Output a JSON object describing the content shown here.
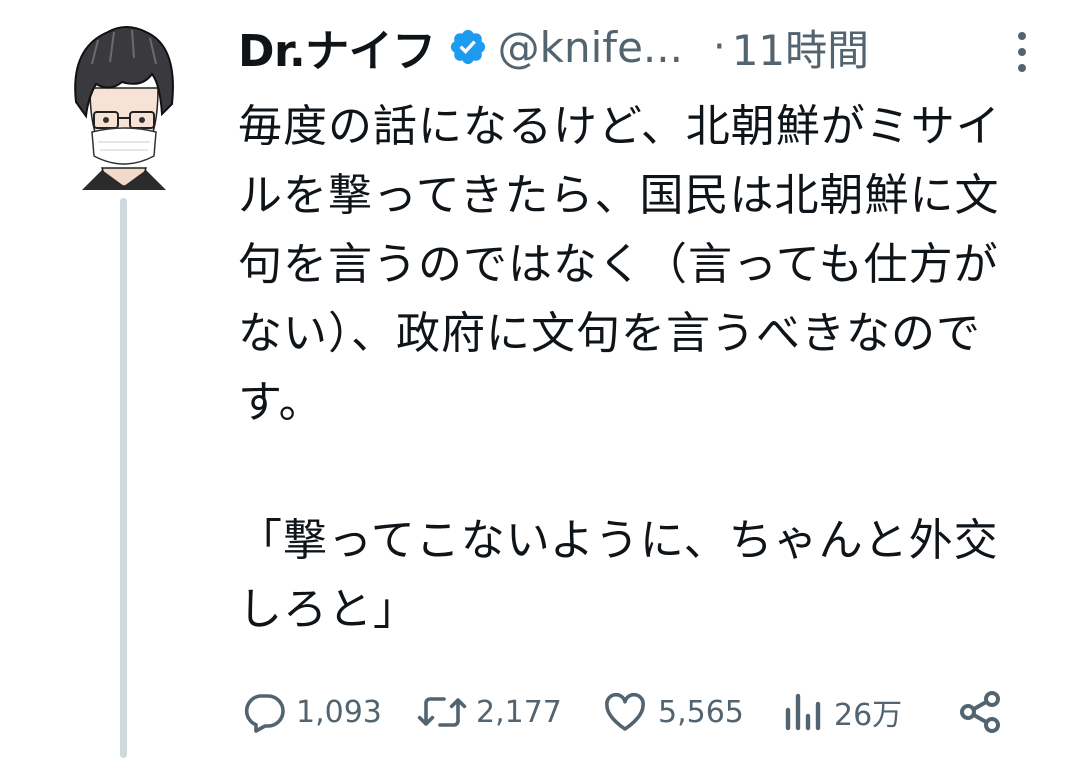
{
  "tweet": {
    "display_name": "Dr.ナイフ",
    "handle": "@knife...",
    "separator": "·",
    "time": "11時間",
    "text": "毎度の話になるけど、北朝鮮がミサイルを撃ってきたら、国民は北朝鮮に文句を言うのではなく（言っても仕方がない）、政府に文句を言うべきなのです。\n\n「撃ってこないように、ちゃんと外交しろと」"
  },
  "actions": {
    "replies": "1,093",
    "retweets": "2,177",
    "likes": "5,565",
    "views": "26万"
  },
  "icons": {
    "verified": "verified-badge-icon",
    "more": "more-vertical-icon",
    "reply": "reply-icon",
    "retweet": "retweet-icon",
    "like": "heart-icon",
    "views": "views-icon",
    "share": "share-icon"
  },
  "colors": {
    "text": "#0f1419",
    "secondary": "#536471",
    "verified": "#1d9bf0",
    "thread_line": "#cfd9de"
  }
}
